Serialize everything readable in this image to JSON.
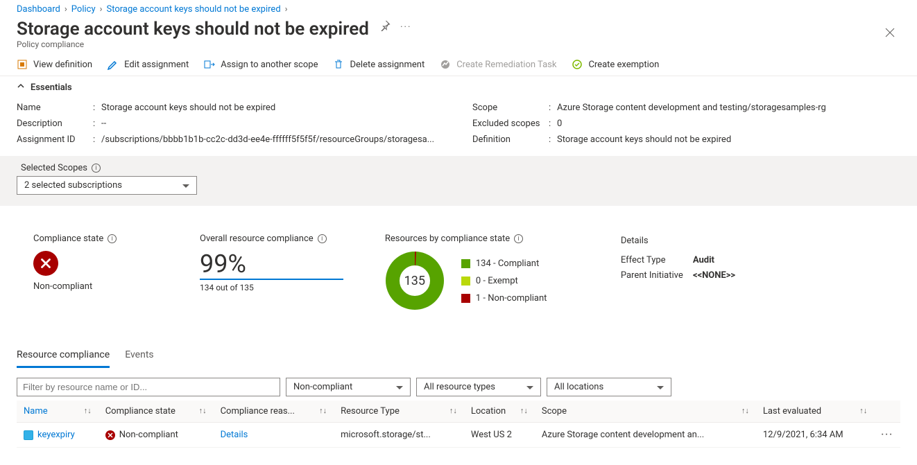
{
  "breadcrumb": [
    "Dashboard",
    "Policy",
    "Storage account keys should not be expired"
  ],
  "header": {
    "title": "Storage account keys should not be expired",
    "subtitle": "Policy compliance"
  },
  "toolbar": {
    "view_definition": "View definition",
    "edit_assignment": "Edit assignment",
    "assign_scope": "Assign to another scope",
    "delete_assignment": "Delete assignment",
    "create_remediation": "Create Remediation Task",
    "create_exemption": "Create exemption"
  },
  "essentials": {
    "toggle_label": "Essentials",
    "left": {
      "name_label": "Name",
      "name_value": "Storage account keys should not be expired",
      "description_label": "Description",
      "description_value": "--",
      "assignment_id_label": "Assignment ID",
      "assignment_id_value": "/subscriptions/bbbb1b1b-cc2c-dd3d-ee4e-ffffff5f5f5f/resourceGroups/storagesa..."
    },
    "right": {
      "scope_label": "Scope",
      "scope_value": "Azure Storage content development and testing/storagesamples-rg",
      "excluded_label": "Excluded scopes",
      "excluded_value": "0",
      "definition_label": "Definition",
      "definition_value": "Storage account keys should not be expired"
    }
  },
  "scopes": {
    "label": "Selected Scopes",
    "selected": "2 selected subscriptions"
  },
  "summary": {
    "compliance_state": {
      "title": "Compliance state",
      "value": "Non-compliant"
    },
    "overall": {
      "title": "Overall resource compliance",
      "percent": "99%",
      "sub": "134 out of 135"
    },
    "by_state": {
      "title": "Resources by compliance state",
      "total": "135",
      "items": [
        {
          "count": "134",
          "label": "Compliant",
          "color": "#57a300"
        },
        {
          "count": "0",
          "label": "Exempt",
          "color": "#bad80a"
        },
        {
          "count": "1",
          "label": "Non-compliant",
          "color": "#a80000"
        }
      ]
    },
    "details": {
      "title": "Details",
      "effect_type_label": "Effect Type",
      "effect_type_value": "Audit",
      "parent_label": "Parent Initiative",
      "parent_value": "<<NONE>>"
    }
  },
  "tabs": {
    "resource_compliance": "Resource compliance",
    "events": "Events"
  },
  "filters": {
    "placeholder": "Filter by resource name or ID...",
    "compliance": "Non-compliant",
    "resource_types": "All resource types",
    "locations": "All locations"
  },
  "table": {
    "headers": {
      "name": "Name",
      "compliance_state": "Compliance state",
      "compliance_reason": "Compliance reas...",
      "resource_type": "Resource Type",
      "location": "Location",
      "scope": "Scope",
      "last_evaluated": "Last evaluated"
    },
    "rows": [
      {
        "name": "keyexpiry",
        "compliance_state": "Non-compliant",
        "compliance_reason": "Details",
        "resource_type": "microsoft.storage/st...",
        "location": "West US 2",
        "scope": "Azure Storage content development an...",
        "last_evaluated": "12/9/2021, 6:34 AM"
      }
    ]
  }
}
